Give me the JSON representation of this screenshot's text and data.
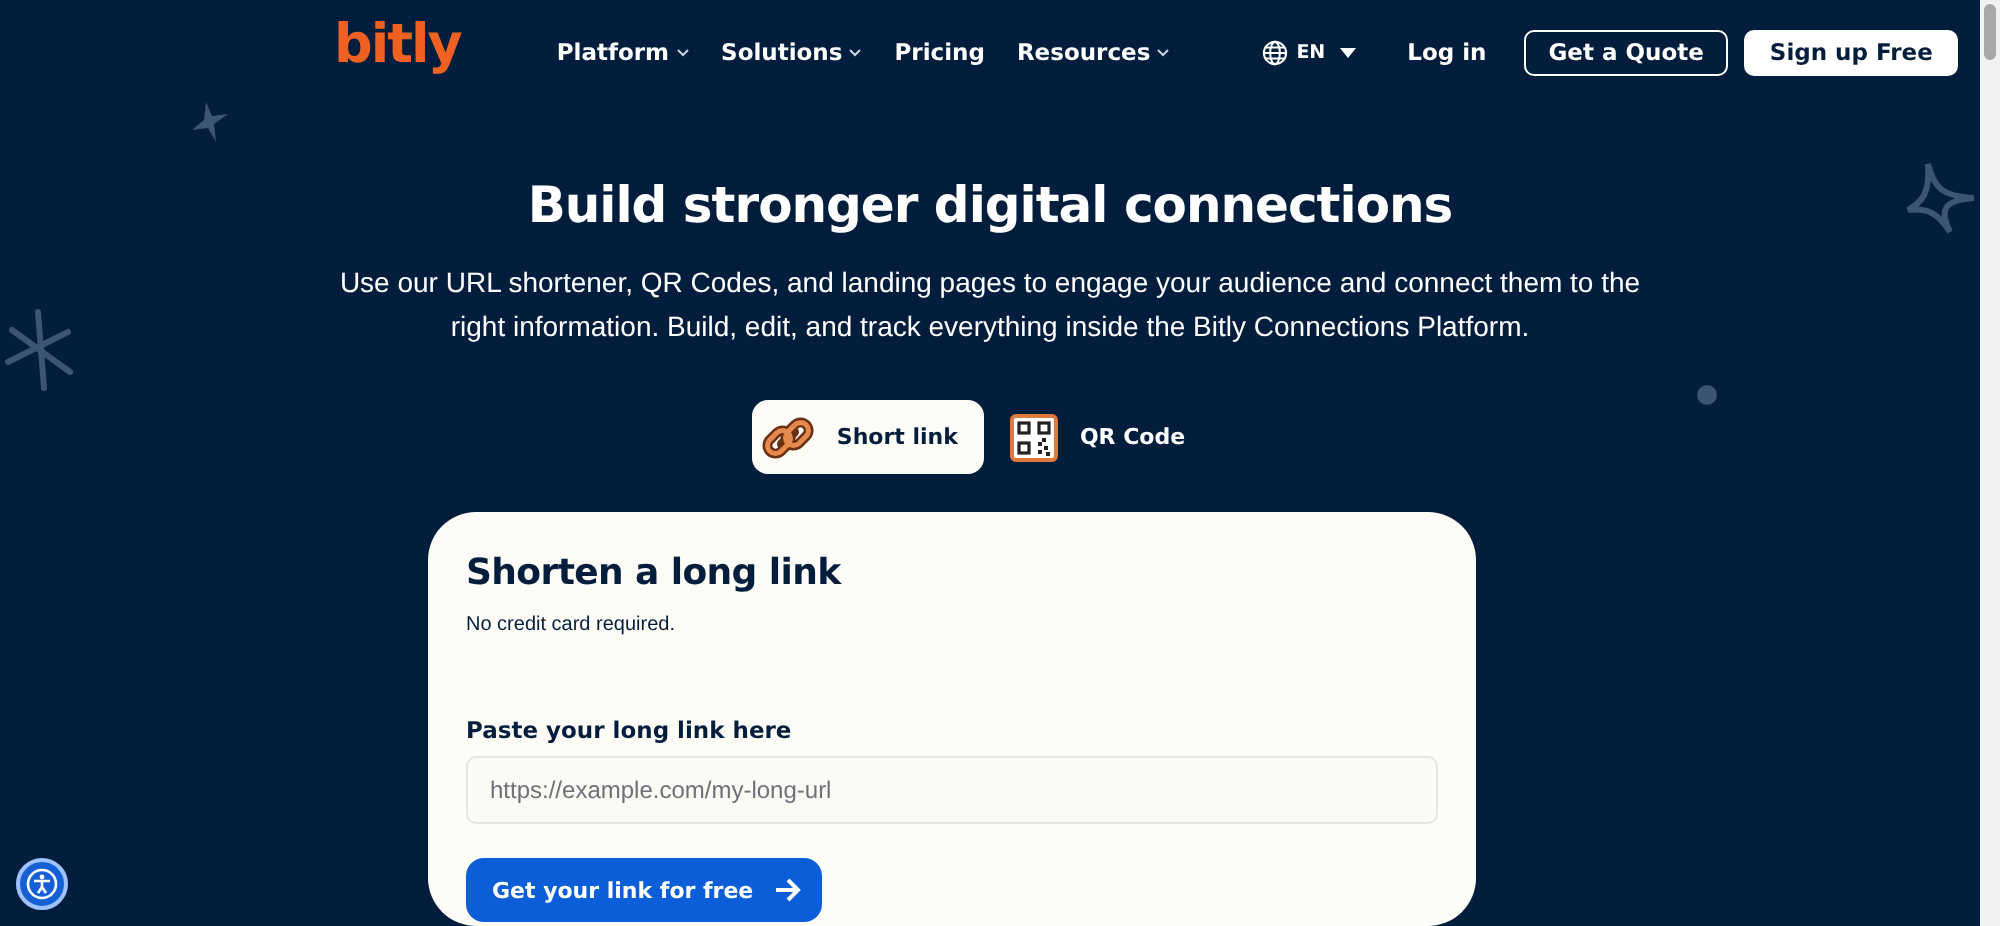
{
  "header": {
    "logo": "bitly",
    "nav": [
      {
        "label": "Platform",
        "has_menu": true
      },
      {
        "label": "Solutions",
        "has_menu": true
      },
      {
        "label": "Pricing",
        "has_menu": false
      },
      {
        "label": "Resources",
        "has_menu": true
      }
    ],
    "language": "EN",
    "login": "Log in",
    "quote_button": "Get a Quote",
    "signup_button": "Sign up Free"
  },
  "hero": {
    "title": "Build stronger digital connections",
    "subtitle": "Use our URL shortener, QR Codes, and landing pages to engage your audience and connect them to the right information. Build, edit, and track everything inside the Bitly Connections Platform."
  },
  "tabs": [
    {
      "label": "Short link",
      "kind": "link",
      "selected": true
    },
    {
      "label": "QR Code",
      "kind": "qr",
      "selected": false
    }
  ],
  "card": {
    "title": "Shorten a long link",
    "note": "No credit card required.",
    "field_label": "Paste your long link here",
    "placeholder": "https://example.com/my-long-url",
    "button": "Get your link for free"
  }
}
